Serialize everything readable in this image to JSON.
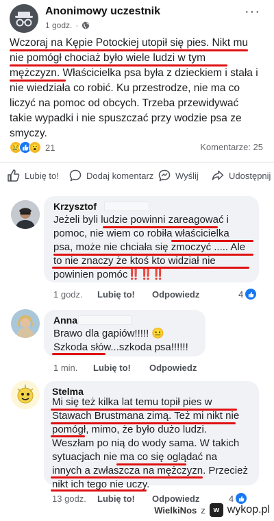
{
  "post": {
    "author": "Anonimowy uczestnik",
    "time": "1 godz.",
    "separator": "·",
    "more": "···",
    "lines": [
      "Wczoraj na Kępie Potockiej utopił się pies. Nikt mu",
      "nie pomógł  chociaż było wiele ludzi w tym",
      "mężczyzn. Właścicielka psa była z dzieckiem i stała i",
      "nie wiedziała co robić. Ku przestrodze, nie ma co",
      "liczyć na pomoc od obcych. Trzeba przewidywać",
      "takie wypadki i nie spuszczać przy wodzie psa ze",
      "smyczy."
    ],
    "reaction_count": "21",
    "comments_count": "Komentarze: 25"
  },
  "actions": {
    "like": "Lubię to!",
    "comment": "Dodaj komentarz",
    "send": "Wyślij",
    "share": "Udostępnij"
  },
  "comments": [
    {
      "name": "Krzysztof",
      "lines": [
        "Jeżeli byli ludzie powinni zareagować i",
        "pomoc, nie wiem co robiła właścicielka",
        "psa, może nie chciała się zmoczyć ..... Ale",
        "to nie znaczy że ktoś kto widział nie",
        "powinien pomóc"
      ],
      "bangs": "‼️‼️‼️",
      "time": "1 godz.",
      "like": "Lubię to!",
      "reply": "Odpowiedz",
      "likes": "4"
    },
    {
      "name": "Anna",
      "lines": [
        "Brawo dla gapiów!!!!! 😐",
        "Szkoda słów...szkoda psa!!!!!!"
      ],
      "time": "1 min.",
      "like": "Lubię to!",
      "reply": "Odpowiedz"
    },
    {
      "name": "Stelma",
      "lines": [
        "Mi się też kilka lat temu topił pies w",
        "Stawach Brustmana zimą. Też mi nikt nie",
        "pomógł, mimo, że było dużo ludzi.",
        "Weszłam po nią do wody sama. W takich",
        "sytuacjach nie ma co się oglądać na",
        "innych a zwłaszcza na mężczyzn. Przecież",
        "nikt ich tego nie uczy."
      ],
      "time": "13 godz.",
      "like": "Lubię to!",
      "reply": "Odpowiedz",
      "likes": "4"
    }
  ],
  "watermark": {
    "user": "WielkiNos",
    "z": "z",
    "logo": "w",
    "site": "wykop.pl"
  },
  "colors": {
    "underline": "#e01010",
    "like_blue": "#1877f2",
    "bubble": "#f0f2f5"
  }
}
